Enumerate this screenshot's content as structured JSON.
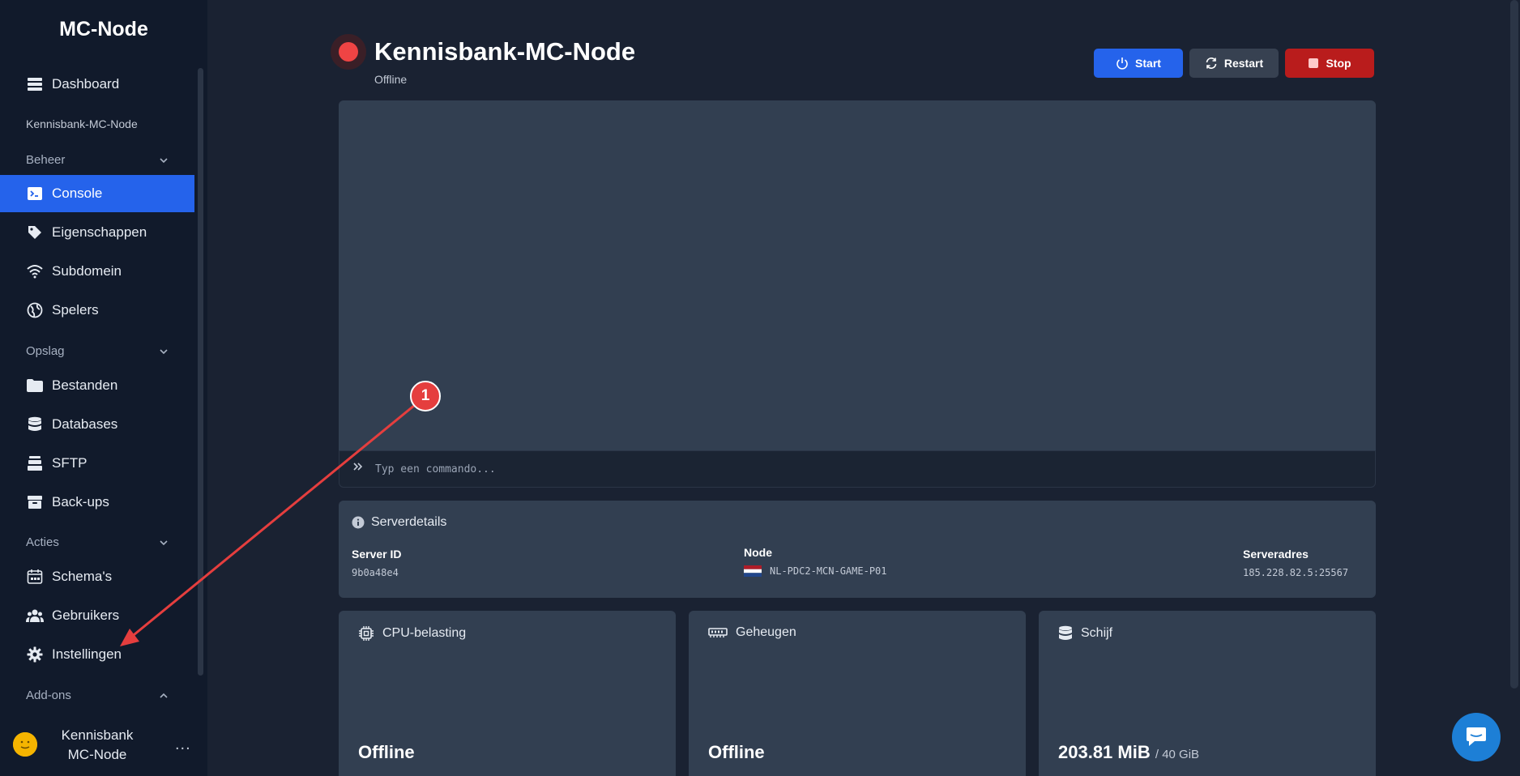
{
  "sidebar": {
    "brand": "MC-Node",
    "dashboard": "Dashboard",
    "server_name": "Kennisbank-MC-Node",
    "sections": {
      "beheer": "Beheer",
      "opslag": "Opslag",
      "acties": "Acties",
      "addons": "Add-ons"
    },
    "items": {
      "console": "Console",
      "eigenschappen": "Eigenschappen",
      "subdomein": "Subdomein",
      "spelers": "Spelers",
      "bestanden": "Bestanden",
      "databases": "Databases",
      "sftp": "SFTP",
      "backups": "Back-ups",
      "schemas": "Schema's",
      "gebruikers": "Gebruikers",
      "instellingen": "Instellingen"
    },
    "user": {
      "name": "Kennisbank MC-Node",
      "more": "..."
    }
  },
  "header": {
    "title": "Kennisbank-MC-Node",
    "status": "Offline",
    "status_color": "#ef4444"
  },
  "buttons": {
    "start": "Start",
    "restart": "Restart",
    "stop": "Stop"
  },
  "console": {
    "placeholder": "Typ een commando..."
  },
  "details": {
    "title": "Serverdetails",
    "server_id_label": "Server ID",
    "server_id": "9b0a48e4",
    "node_label": "Node",
    "node": "NL-PDC2-MCN-GAME-P01",
    "address_label": "Serveradres",
    "address": "185.228.82.5:25567"
  },
  "cards": {
    "cpu": {
      "title": "CPU-belasting",
      "value": "Offline"
    },
    "memory": {
      "title": "Geheugen",
      "value": "Offline"
    },
    "disk": {
      "title": "Schijf",
      "value": "203.81 MiB",
      "limit": "/ 40 GiB"
    }
  },
  "annotation": {
    "number": "1",
    "color": "#e53e3e"
  },
  "colors": {
    "accent": "#2563eb",
    "danger": "#b91c1c",
    "sidebar": "#111a2b"
  }
}
